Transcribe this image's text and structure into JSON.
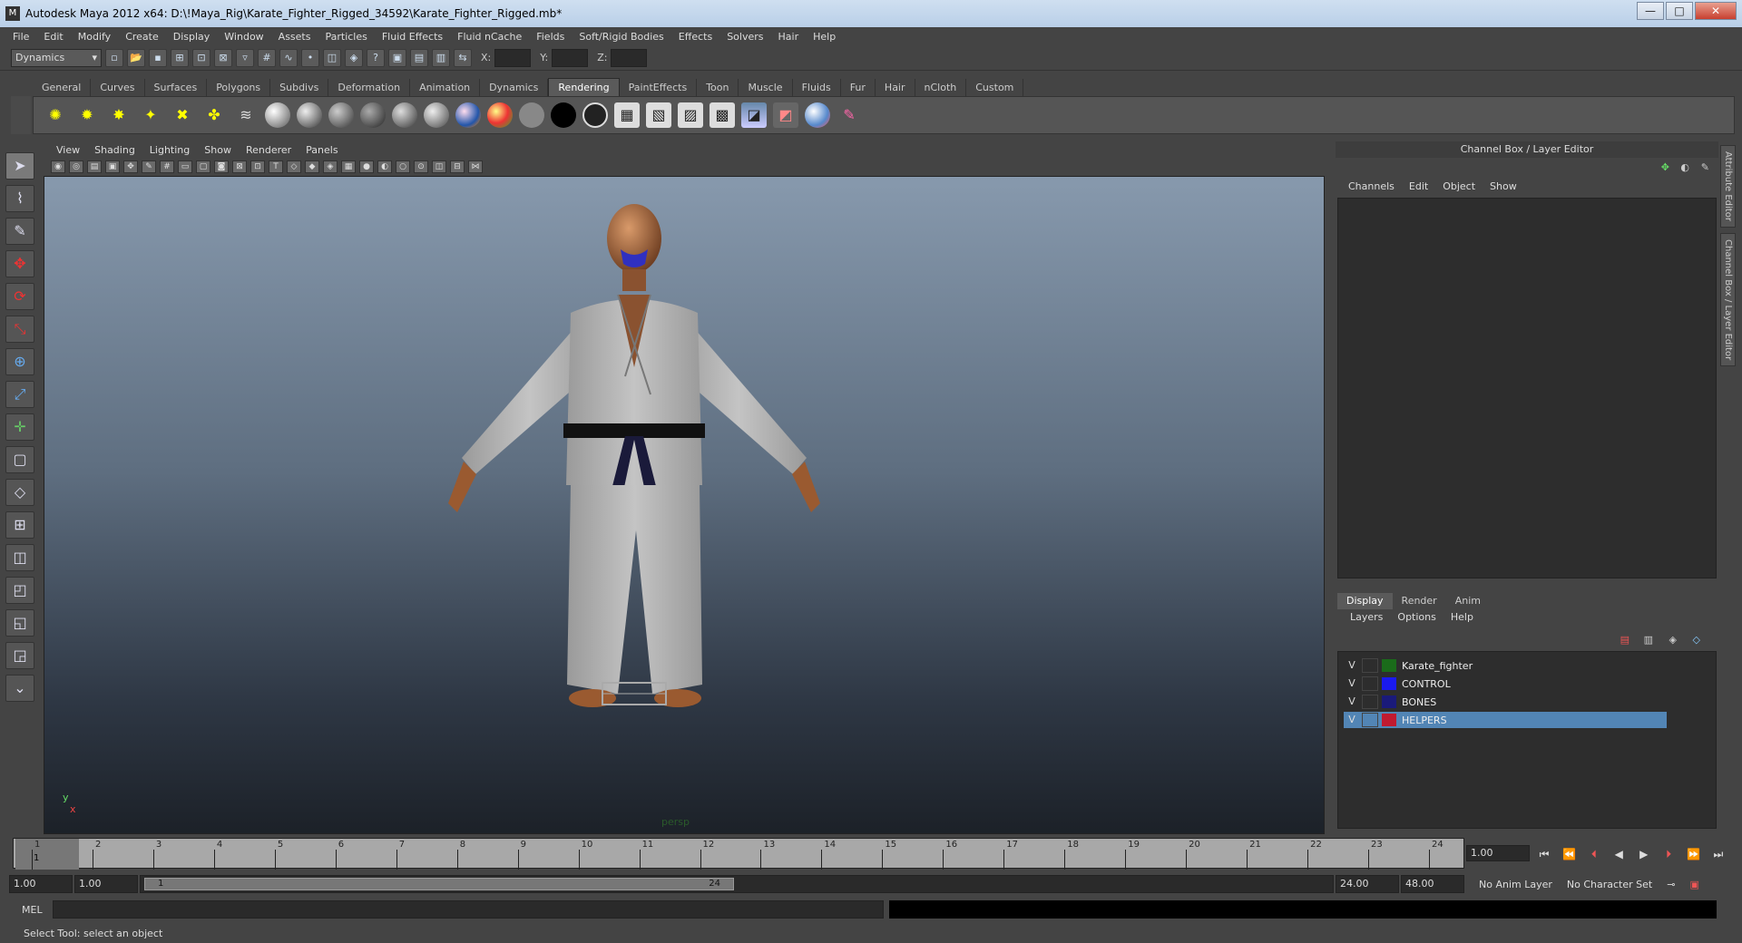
{
  "window": {
    "title": "Autodesk Maya 2012 x64: D:\\!Maya_Rig\\Karate_Fighter_Rigged_34592\\Karate_Fighter_Rigged.mb*",
    "minimize": "—",
    "maximize": "□",
    "close": "✕"
  },
  "menubar": [
    "File",
    "Edit",
    "Modify",
    "Create",
    "Display",
    "Window",
    "Assets",
    "Particles",
    "Fluid Effects",
    "Fluid nCache",
    "Fields",
    "Soft/Rigid Bodies",
    "Effects",
    "Solvers",
    "Hair",
    "Help"
  ],
  "statusline": {
    "menuset": "Dynamics",
    "x_label": "X:",
    "y_label": "Y:",
    "z_label": "Z:"
  },
  "shelf": {
    "tabs": [
      "General",
      "Curves",
      "Surfaces",
      "Polygons",
      "Subdivs",
      "Deformation",
      "Animation",
      "Dynamics",
      "Rendering",
      "PaintEffects",
      "Toon",
      "Muscle",
      "Fluids",
      "Fur",
      "Hair",
      "nCloth",
      "Custom"
    ],
    "active_tab": "Rendering"
  },
  "viewport": {
    "menu": [
      "View",
      "Shading",
      "Lighting",
      "Show",
      "Renderer",
      "Panels"
    ],
    "camera_label": "persp",
    "axis_y": "y",
    "axis_x": "x"
  },
  "channelbox": {
    "title": "Channel Box / Layer Editor",
    "menu": [
      "Channels",
      "Edit",
      "Object",
      "Show"
    ],
    "side_tabs": [
      "Attribute Editor",
      "Channel Box / Layer Editor"
    ]
  },
  "layers": {
    "tabs": [
      "Display",
      "Render",
      "Anim"
    ],
    "active_tab": "Display",
    "menu": [
      "Layers",
      "Options",
      "Help"
    ],
    "items": [
      {
        "visible": "V",
        "name": "Karate_fighter",
        "color": "#1a6b1a",
        "selected": false
      },
      {
        "visible": "V",
        "name": "CONTROL",
        "color": "#1a1aee",
        "selected": false
      },
      {
        "visible": "V",
        "name": "BONES",
        "color": "#1a1a7a",
        "selected": false
      },
      {
        "visible": "V",
        "name": "HELPERS",
        "color": "#c01a30",
        "selected": true
      }
    ]
  },
  "timeslider": {
    "ticks": [
      "1",
      "2",
      "3",
      "4",
      "5",
      "6",
      "7",
      "8",
      "9",
      "10",
      "11",
      "12",
      "13",
      "14",
      "15",
      "16",
      "17",
      "18",
      "19",
      "20",
      "21",
      "22",
      "23",
      "24"
    ],
    "current_frame": "1",
    "current_frame_field": "1.00"
  },
  "range": {
    "start": "1.00",
    "playback_start": "1.00",
    "thumb_start": "1",
    "thumb_end": "24",
    "playback_end": "24.00",
    "end": "48.00",
    "anim_layer": "No Anim Layer",
    "character_set": "No Character Set"
  },
  "mel": {
    "label": "MEL"
  },
  "helpline": "Select Tool: select an object"
}
